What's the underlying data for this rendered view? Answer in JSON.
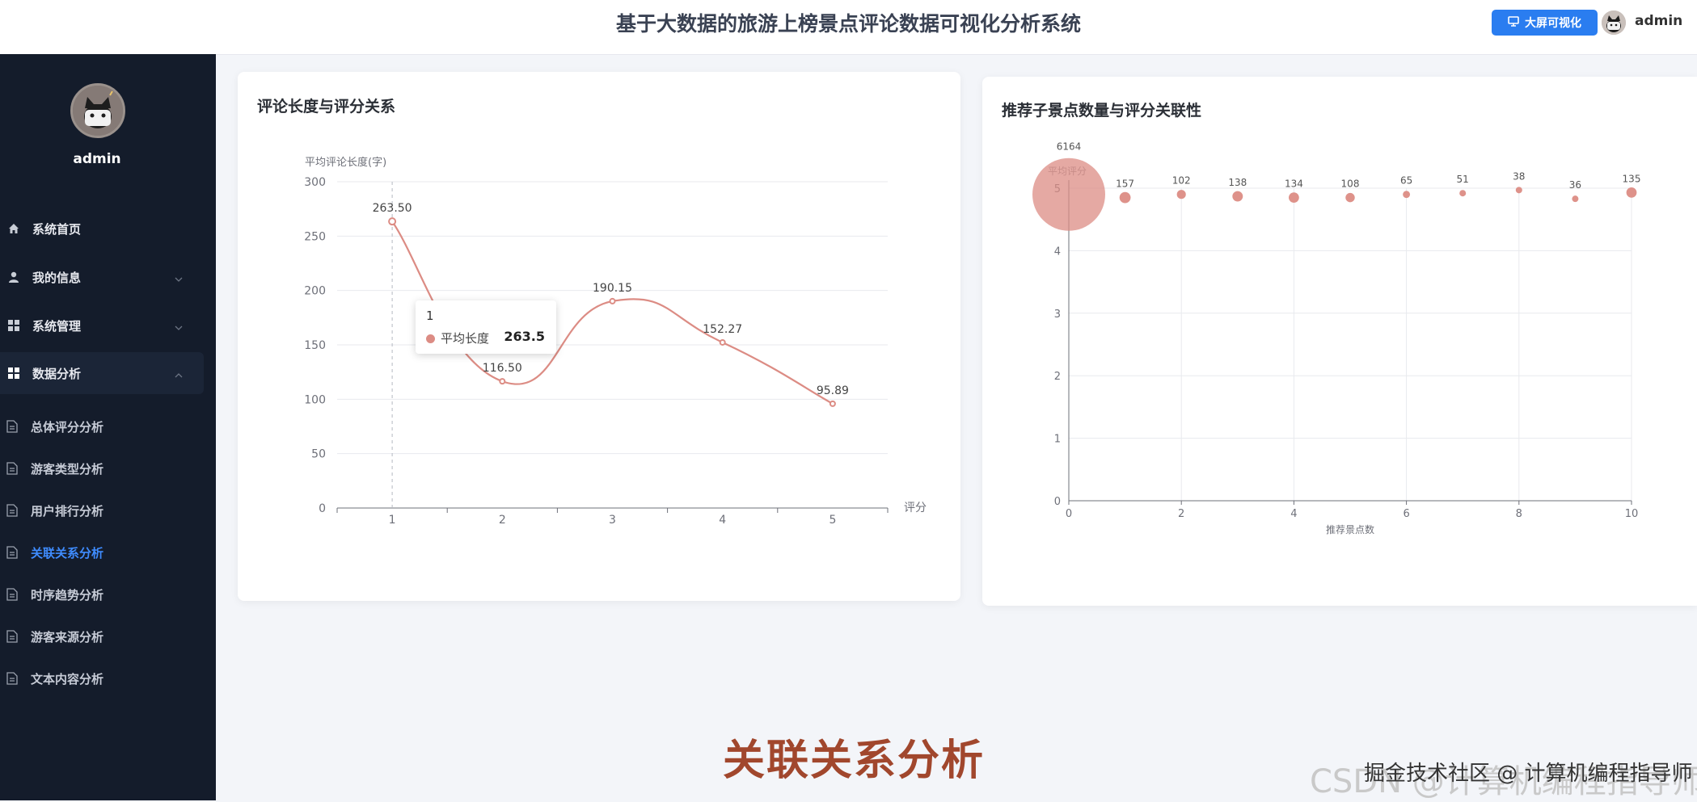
{
  "header": {
    "title": "基于大数据的旅游上榜景点评论数据可视化分析系统",
    "bigscreen_label": "大屏可视化",
    "username": "admin"
  },
  "sidebar": {
    "username": "admin",
    "menu": [
      {
        "label": "系统首页",
        "icon": "home-icon",
        "has_chevron": false
      },
      {
        "label": "我的信息",
        "icon": "user-icon",
        "has_chevron": true
      },
      {
        "label": "系统管理",
        "icon": "grid-icon",
        "has_chevron": true
      },
      {
        "label": "数据分析",
        "icon": "grid-icon",
        "has_chevron": true,
        "expanded": true
      }
    ],
    "submenu": [
      {
        "label": "总体评分分析"
      },
      {
        "label": "游客类型分析"
      },
      {
        "label": "用户排行分析"
      },
      {
        "label": "关联关系分析",
        "selected": true
      },
      {
        "label": "时序趋势分析"
      },
      {
        "label": "游客来源分析"
      },
      {
        "label": "文本内容分析"
      }
    ]
  },
  "colors": {
    "accent": "#2a7df0",
    "sidebar_bg": "#141c2b",
    "series": "#dc8c84",
    "selected_menu": "#3f8cff"
  },
  "cards": {
    "left_title": "评论长度与评分关系",
    "right_title": "推荐子景点数量与评分关联性"
  },
  "tooltip": {
    "header": "1",
    "series_name": "平均长度",
    "value": "263.5"
  },
  "chart_data": [
    {
      "type": "line",
      "smooth": true,
      "ylabel": "平均评论长度(字)",
      "xlabel": "评分",
      "categories": [
        "1",
        "2",
        "3",
        "4",
        "5"
      ],
      "series": [
        {
          "name": "平均长度",
          "values": [
            263.5,
            116.5,
            190.15,
            152.27,
            95.89
          ]
        }
      ],
      "data_labels": [
        "263.50",
        "116.50",
        "190.15",
        "152.27",
        "95.89"
      ],
      "ylim": [
        0,
        300
      ],
      "yticks": [
        "0",
        "50",
        "100",
        "150",
        "200",
        "250",
        "300"
      ],
      "grid": "horizontal",
      "hover_category": "1"
    },
    {
      "type": "scatter",
      "ylabel": "平均评分",
      "xlabel": "推荐景点数",
      "x": [
        0,
        1,
        2,
        3,
        4,
        5,
        6,
        7,
        8,
        9,
        10
      ],
      "y": [
        4.9,
        4.85,
        4.9,
        4.87,
        4.85,
        4.85,
        4.9,
        4.92,
        4.97,
        4.83,
        4.93
      ],
      "sizes": [
        6164,
        157,
        102,
        138,
        134,
        108,
        65,
        51,
        38,
        36,
        135
      ],
      "data_labels": [
        "6164",
        "157",
        "102",
        "138",
        "134",
        "108",
        "65",
        "51",
        "38",
        "36",
        "135"
      ],
      "xlim": [
        0,
        10
      ],
      "ylim": [
        0,
        5
      ],
      "xticks": [
        "0",
        "2",
        "4",
        "6",
        "8",
        "10"
      ],
      "yticks": [
        "0",
        "1",
        "2",
        "3",
        "4",
        "5"
      ],
      "grid": "both"
    }
  ],
  "page": {
    "bottom_title": "关联关系分析",
    "watermark_csdn": "CSDN @计算机编程指导师",
    "watermark_juejin": "掘金技术社区 @ 计算机编程指导师"
  }
}
